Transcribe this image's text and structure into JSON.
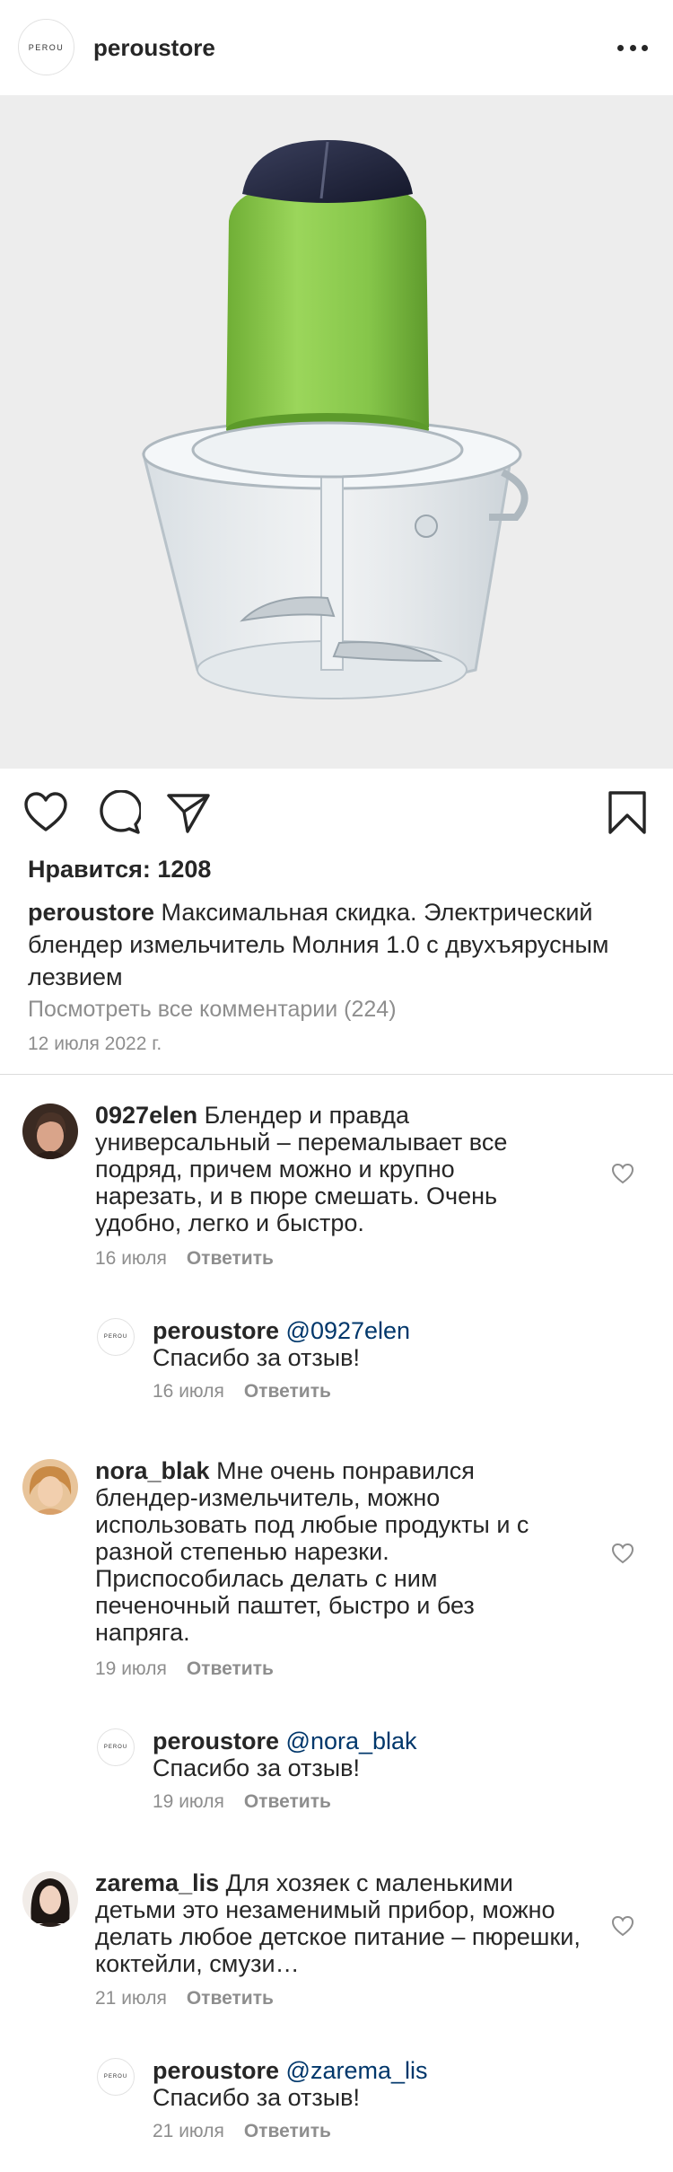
{
  "header": {
    "avatar_text": "PEROU",
    "username": "peroustore",
    "more_icon": "more-horizontal-icon"
  },
  "post": {
    "likes_label": "Нравится: 1208",
    "caption_username": "peroustore",
    "caption_text": " Максимальная скидка. Электрический блендер измельчитель Молния 1.0 с двухъярусным лезвием",
    "view_comments": "Посмотреть все комментарии (224)",
    "date": "12 июля 2022 г."
  },
  "icons": {
    "like": "heart-outline-icon",
    "comment": "comment-bubble-icon",
    "share": "paper-plane-icon",
    "save": "bookmark-icon"
  },
  "colors": {
    "text": "#262626",
    "secondary": "#8e8e8e",
    "mention": "#00376b",
    "blender_green": "#86c64a"
  },
  "comments": [
    {
      "username": "0927elen",
      "text": " Блендер и правда универсальный – перемалывает все подряд, причем можно и крупно нарезать, и в пюре смешать. Очень удобно, легко и быстро.",
      "date": "16 июля",
      "reply_label": "Ответить",
      "reply": {
        "username": "peroustore",
        "mention": " @0927elen",
        "text": "Спасибо за отзыв!",
        "date": "16 июля",
        "reply_label": "Ответить"
      }
    },
    {
      "username": "nora_blak",
      "text": " Мне очень понравился блендер-измельчитель, можно использовать под любые продукты и с разной степенью нарезки. Приспособилась делать с ним печеночный паштет, быстро и без напряга.",
      "date": "19 июля",
      "reply_label": "Ответить",
      "reply": {
        "username": "peroustore",
        "mention": " @nora_blak",
        "text": "Спасибо за отзыв!",
        "date": "19 июля",
        "reply_label": "Ответить"
      }
    },
    {
      "username": "zarema_lis",
      "text": " Для хозяек с маленькими детьми это незаменимый прибор, можно делать любое детское питание – пюрешки, коктейли, смузи…",
      "date": "21 июля",
      "reply_label": "Ответить",
      "reply": {
        "username": "peroustore",
        "mention": " @zarema_lis",
        "text": "Спасибо за отзыв!",
        "date": "21 июля",
        "reply_label": "Ответить"
      }
    }
  ]
}
